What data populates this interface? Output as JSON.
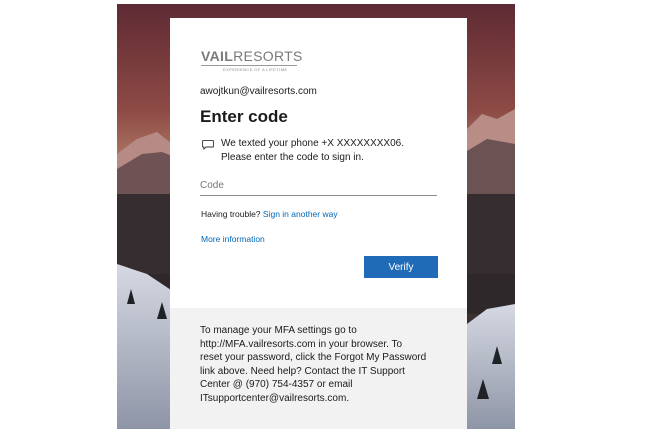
{
  "brand": {
    "logo_text_bold": "VAIL",
    "logo_text_light": "RESORTS",
    "logo_tagline": "EXPERIENCE OF A LIFETIME"
  },
  "account": {
    "email": "awojtkun@vailresorts.com"
  },
  "form": {
    "title": "Enter code",
    "message_line1": "We texted your phone +X XXXXXXXX06.",
    "message_line2": "Please enter the code to sign in.",
    "code_placeholder": "Code",
    "code_value": "",
    "trouble_text": "Having trouble?",
    "trouble_link": "Sign in another way",
    "more_info_link": "More information",
    "verify_label": "Verify"
  },
  "footer": {
    "lines": [
      "To manage your MFA settings go to",
      "http://MFA.vailresorts.com in your browser. To",
      "reset your password, click the Forgot My Password",
      "link above. Need help? Contact the IT Support",
      "Center @ (970) 754-4357 or email",
      "ITsupportcenter@vailresorts.com."
    ]
  },
  "icons": {
    "message": "message-icon"
  },
  "colors": {
    "accent": "#0067b8",
    "button": "#1f6bb8",
    "footer_bg": "#f2f2f2"
  }
}
